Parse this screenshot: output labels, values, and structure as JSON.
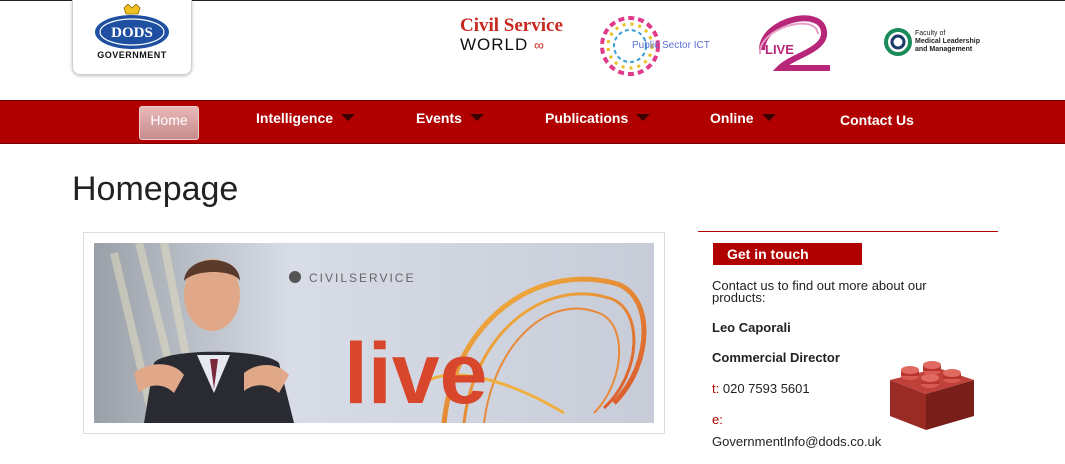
{
  "header": {
    "logo": {
      "brand": "DODS",
      "sub": "GOVERNMENT"
    },
    "partners": {
      "csw_line1": "Civil Service",
      "csw_line2": "WORLD",
      "psi": "Public Sector ICT",
      "live": "LIVE",
      "fmlm_line1": "Faculty of",
      "fmlm_line2": "Medical Leadership",
      "fmlm_line3": "and Management"
    }
  },
  "nav": {
    "home": "Home",
    "items": [
      {
        "label": "Intelligence",
        "dropdown": true
      },
      {
        "label": "Events",
        "dropdown": true
      },
      {
        "label": "Publications",
        "dropdown": true
      },
      {
        "label": "Online",
        "dropdown": true
      },
      {
        "label": "Contact Us",
        "dropdown": false
      }
    ]
  },
  "page": {
    "title": "Homepage"
  },
  "hero": {
    "banner_text": "CIVILSERVICE",
    "banner_word": "live"
  },
  "sidebar": {
    "heading": "Get in touch",
    "intro": "Contact us to find out more about our products:",
    "name": "Leo Caporali",
    "role": "Commercial Director",
    "phone_label": "t:",
    "phone": "020 7593 5601",
    "email_label": "e:",
    "email": "GovernmentInfo@dods.co.uk"
  },
  "colors": {
    "brand_red": "#b00000",
    "nav_caret": "#3a0000"
  }
}
